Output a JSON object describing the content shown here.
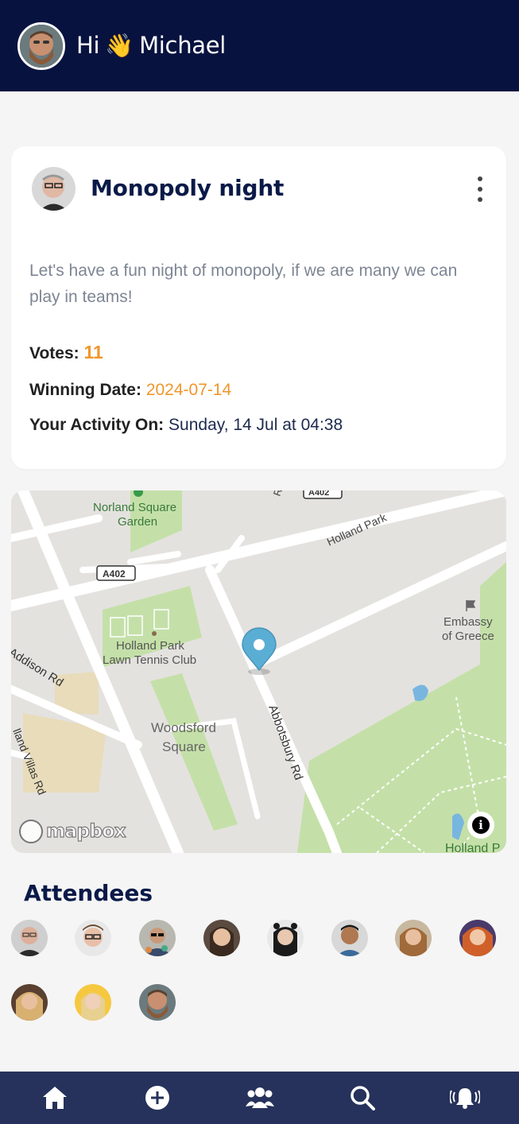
{
  "header": {
    "wave_emoji": "👋",
    "greeting_prefix": "Hi",
    "user_name": "Michael",
    "user_avatar_icon": "user-avatar-bearded-man"
  },
  "event": {
    "title": "Monopoly night",
    "host_avatar_icon": "host-avatar",
    "description": "Let's have a fun night of monopoly, if we are many we can play in teams!",
    "votes_label": "Votes:",
    "votes_value": "11",
    "winning_date_label": "Winning Date:",
    "winning_date_value": "2024-07-14",
    "activity_label": "Your Activity On:",
    "activity_value": "Sunday, 14 Jul at 04:38",
    "accent_color": "#f0962c"
  },
  "map": {
    "labels": {
      "norland": "Norland Square",
      "garden": "Garden",
      "holland_park": "Holland Park",
      "a402_top": "A402",
      "a402": "A402",
      "embassy1": "Embassy",
      "embassy2": "of Greece",
      "tennis1": "Holland Park",
      "tennis2": "Lawn Tennis Club",
      "woodsford1": "Woodsford",
      "woodsford2": "Square",
      "addison": "Addison Rd",
      "villas": "lland Villas Rd",
      "abbotsbury": "Abbotsbury Rd",
      "holland_bottom": "Holland P",
      "rd_top": "Rd"
    },
    "watermark": "mapbox",
    "info_symbol": "i"
  },
  "attendees": {
    "title": "Attendees",
    "count": 11
  },
  "bottom_nav": [
    {
      "icon": "home-icon"
    },
    {
      "icon": "add-circle-icon"
    },
    {
      "icon": "group-icon"
    },
    {
      "icon": "search-icon"
    },
    {
      "icon": "notification-bell-icon"
    }
  ]
}
